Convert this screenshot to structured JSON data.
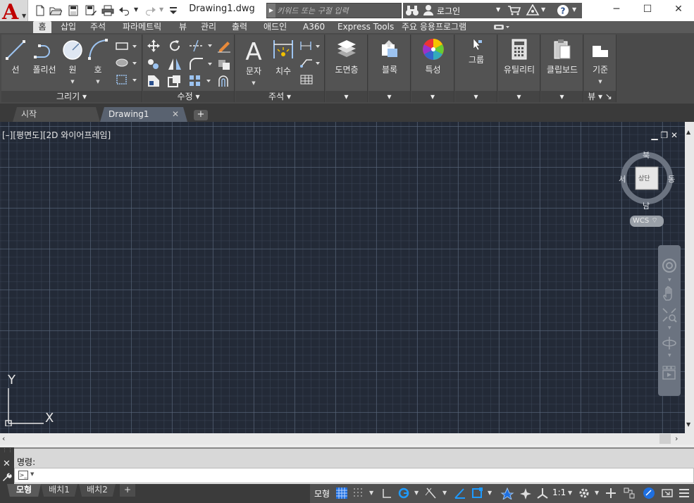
{
  "titlebar": {
    "document": "Drawing1.dwg",
    "search_placeholder": "키워드 또는 구절 입력",
    "login": "로그인"
  },
  "ribbon_tabs": [
    {
      "label": "홈",
      "active": true
    },
    {
      "label": "삽입"
    },
    {
      "label": "주석"
    },
    {
      "label": "파라메트릭"
    },
    {
      "label": "뷰"
    },
    {
      "label": "관리"
    },
    {
      "label": "출력"
    },
    {
      "label": "애드인"
    },
    {
      "label": "A360"
    },
    {
      "label": "Express Tools"
    },
    {
      "label": "주요 응용프로그램"
    }
  ],
  "ribbon": {
    "draw": {
      "label": "그리기",
      "line": "선",
      "polyline": "폴리선",
      "circle": "원",
      "arc": "호"
    },
    "modify": {
      "label": "수정"
    },
    "annotation": {
      "label": "주석",
      "text": "문자",
      "dimension": "치수"
    },
    "layers": "도면층",
    "block": "블록",
    "properties": "특성",
    "groups": "그룹",
    "utilities": "유틸리티",
    "clipboard": "클립보드",
    "view": {
      "base": "기준",
      "label": "뷰"
    }
  },
  "file_tabs": {
    "start": "시작",
    "drawing": "Drawing1",
    "add": "+"
  },
  "viewport": {
    "label": "[–][평면도][2D 와이어프레임]",
    "controls": "▁ ❐ ✕"
  },
  "viewcube": {
    "north": "북",
    "south": "남",
    "east": "동",
    "west": "서",
    "face": "상단",
    "wcs": "WCS"
  },
  "ucs": {
    "x": "X",
    "y": "Y"
  },
  "command": {
    "history": "명령:",
    "input_value": ""
  },
  "status": {
    "tab_model": "모형",
    "tab_layout1": "배치1",
    "tab_layout2": "배치2",
    "tab_add": "+",
    "model_label": "모형",
    "scale": "1:1"
  },
  "colors": {
    "canvas": "#232a37",
    "ribbon": "#535353",
    "accent_blue": "#1e6fe0",
    "logo_red": "#c00000"
  }
}
